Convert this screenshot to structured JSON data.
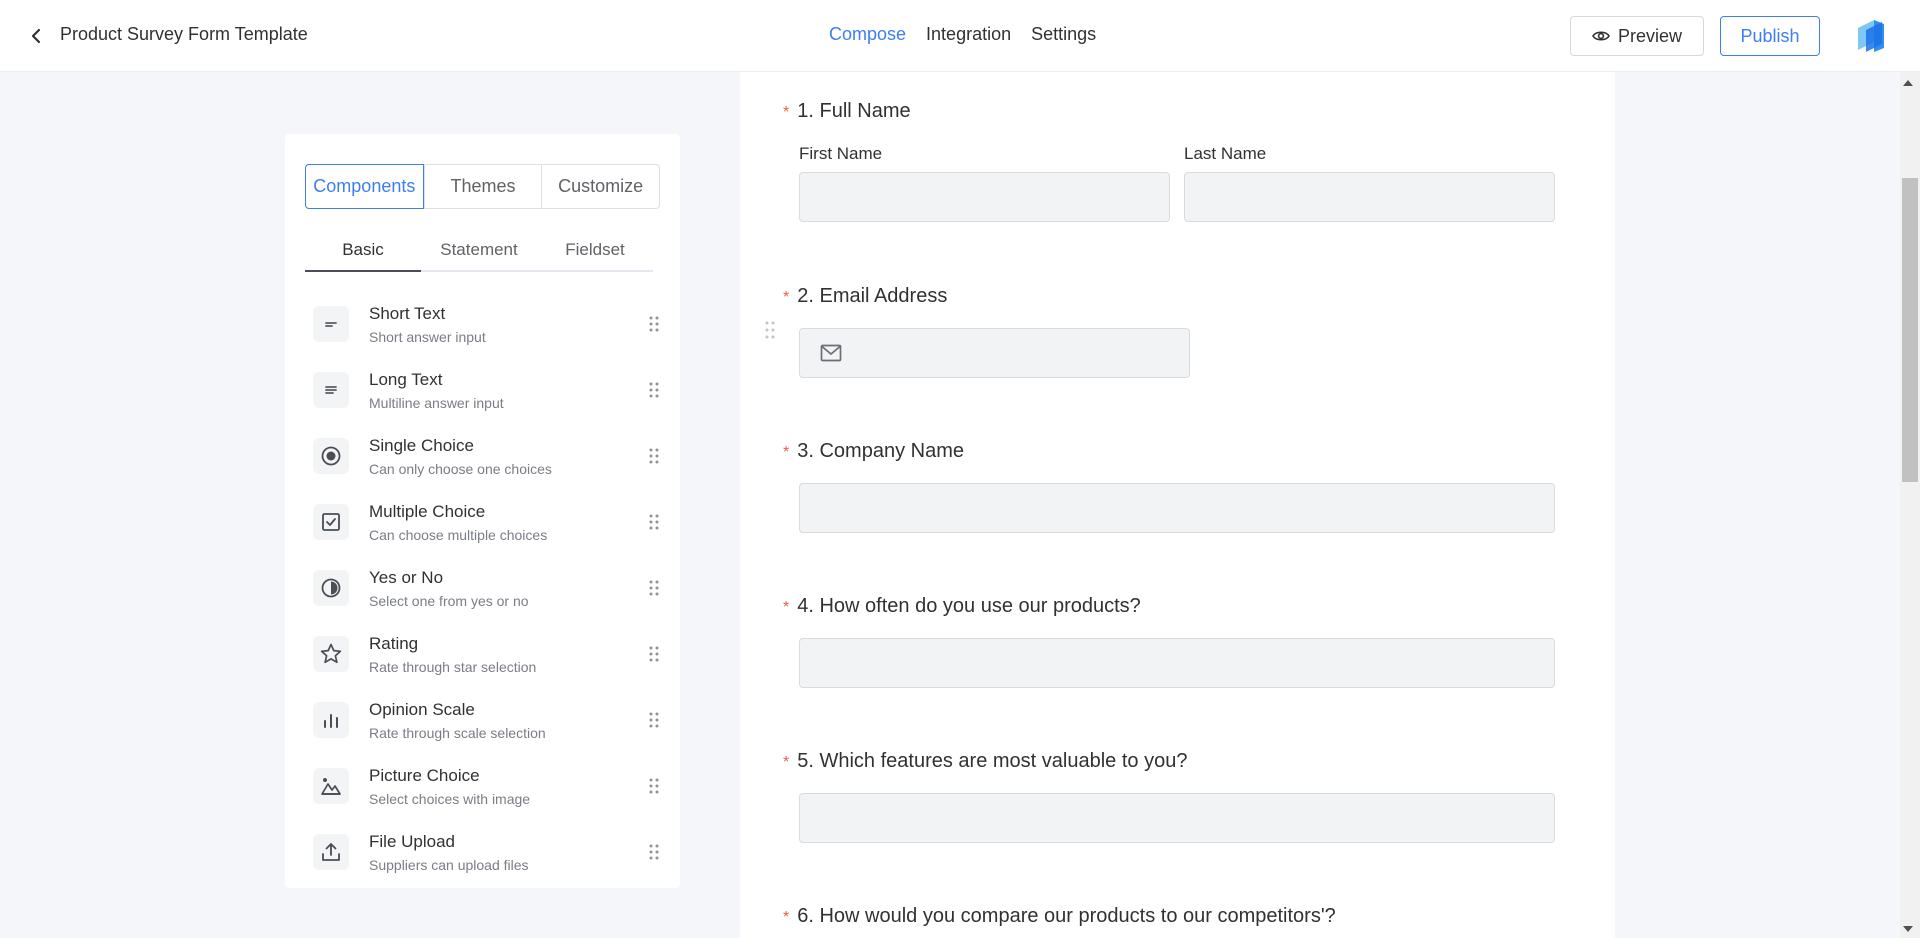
{
  "header": {
    "title": "Product Survey Form Template",
    "tabs": [
      {
        "label": "Compose",
        "active": true
      },
      {
        "label": "Integration",
        "active": false
      },
      {
        "label": "Settings",
        "active": false
      }
    ],
    "preview_label": "Preview",
    "publish_label": "Publish"
  },
  "panel": {
    "segments": [
      {
        "label": "Components",
        "active": true
      },
      {
        "label": "Themes",
        "active": false
      },
      {
        "label": "Customize",
        "active": false
      }
    ],
    "subtabs": [
      {
        "label": "Basic",
        "active": true
      },
      {
        "label": "Statement",
        "active": false
      },
      {
        "label": "Fieldset",
        "active": false
      }
    ],
    "components": [
      {
        "name": "Short Text",
        "desc": "Short answer input",
        "icon": "short-text-icon"
      },
      {
        "name": "Long Text",
        "desc": "Multiline answer input",
        "icon": "long-text-icon"
      },
      {
        "name": "Single Choice",
        "desc": "Can only choose one choices",
        "icon": "radio-icon"
      },
      {
        "name": "Multiple Choice",
        "desc": "Can choose multiple choices",
        "icon": "checkbox-icon"
      },
      {
        "name": "Yes or No",
        "desc": "Select one from yes or no",
        "icon": "half-circle-icon"
      },
      {
        "name": "Rating",
        "desc": "Rate through star selection",
        "icon": "star-icon"
      },
      {
        "name": "Opinion Scale",
        "desc": "Rate through scale selection",
        "icon": "bar-chart-icon"
      },
      {
        "name": "Picture Choice",
        "desc": "Select choices with image",
        "icon": "picture-icon"
      },
      {
        "name": "File Upload",
        "desc": "Suppliers can upload files",
        "icon": "upload-icon"
      }
    ]
  },
  "form": {
    "questions": [
      {
        "number": "1.",
        "title": "Full Name",
        "required": "*",
        "first_label": "First Name",
        "last_label": "Last Name"
      },
      {
        "number": "2.",
        "title": "Email Address",
        "required": "*"
      },
      {
        "number": "3.",
        "title": "Company Name",
        "required": "*"
      },
      {
        "number": "4.",
        "title": "How often do you use our products?",
        "required": "*"
      },
      {
        "number": "5.",
        "title": "Which features are most valuable to you?",
        "required": "*"
      },
      {
        "number": "6.",
        "title": "How would you compare our products to our competitors'?",
        "required": "*"
      }
    ]
  },
  "colors": {
    "accent": "#3d7ff0",
    "required": "#f15a4a",
    "input_bg": "#f2f3f5"
  }
}
